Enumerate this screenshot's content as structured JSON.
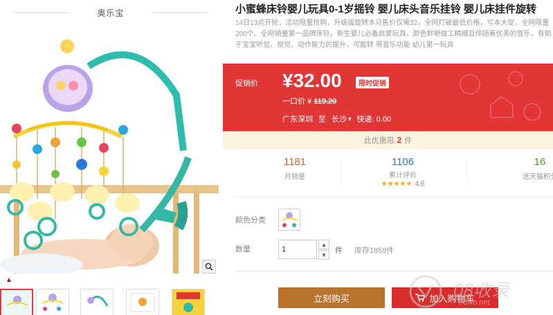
{
  "gallery": {
    "brand": "奥乐宝",
    "zoom_icon": "magnifier-icon",
    "scroll_up_icon": "triangle-up-icon"
  },
  "product": {
    "title": "小蜜蜂床铃婴儿玩具0-1岁摇铃 婴儿床头音乐挂铃 婴儿床挂件旋转",
    "subtitle": "14日13点开抢，活动限量抢购，升级版旋转木马售价仅需32，全网打破最低价格，亏本大促，全网限量200个。全网销量第一品牌床铃，新生婴儿必备启蒙玩具，颜色鲜艳做工精细且伴随着优美的音乐，有助于宝宝听觉、视觉、动作能力的提升，可旋转 带音乐功能 幼儿第一玩具"
  },
  "price": {
    "label": "促销价",
    "value": "¥32.00",
    "tag": "限时促销",
    "orig_label": "一口价",
    "orig_currency": "¥",
    "orig_value": "119.20",
    "from": "广东深圳",
    "to_label": "至",
    "to": "长沙",
    "shipping": "快递: 0.00",
    "accent": "#e23636"
  },
  "limit": {
    "prefix": "此优惠限",
    "count": "2",
    "suffix": "件"
  },
  "stats": {
    "monthly_sales": "1181",
    "monthly_label": "月销量",
    "reviews": "1106",
    "reviews_label": "累计评价",
    "rating": "4.6",
    "rating_stars": "★★★★★",
    "points": "16",
    "points_label": "送天猫积分"
  },
  "options": {
    "color_label": "颜色分类",
    "qty_label": "数量",
    "qty_value": "1",
    "qty_unit": "件",
    "stock": "库存1859件"
  },
  "actions": {
    "buy": "立刻购买",
    "cart": "加入购物车"
  },
  "watermark": {
    "text": "08收录",
    "sub": "08wo.net"
  }
}
